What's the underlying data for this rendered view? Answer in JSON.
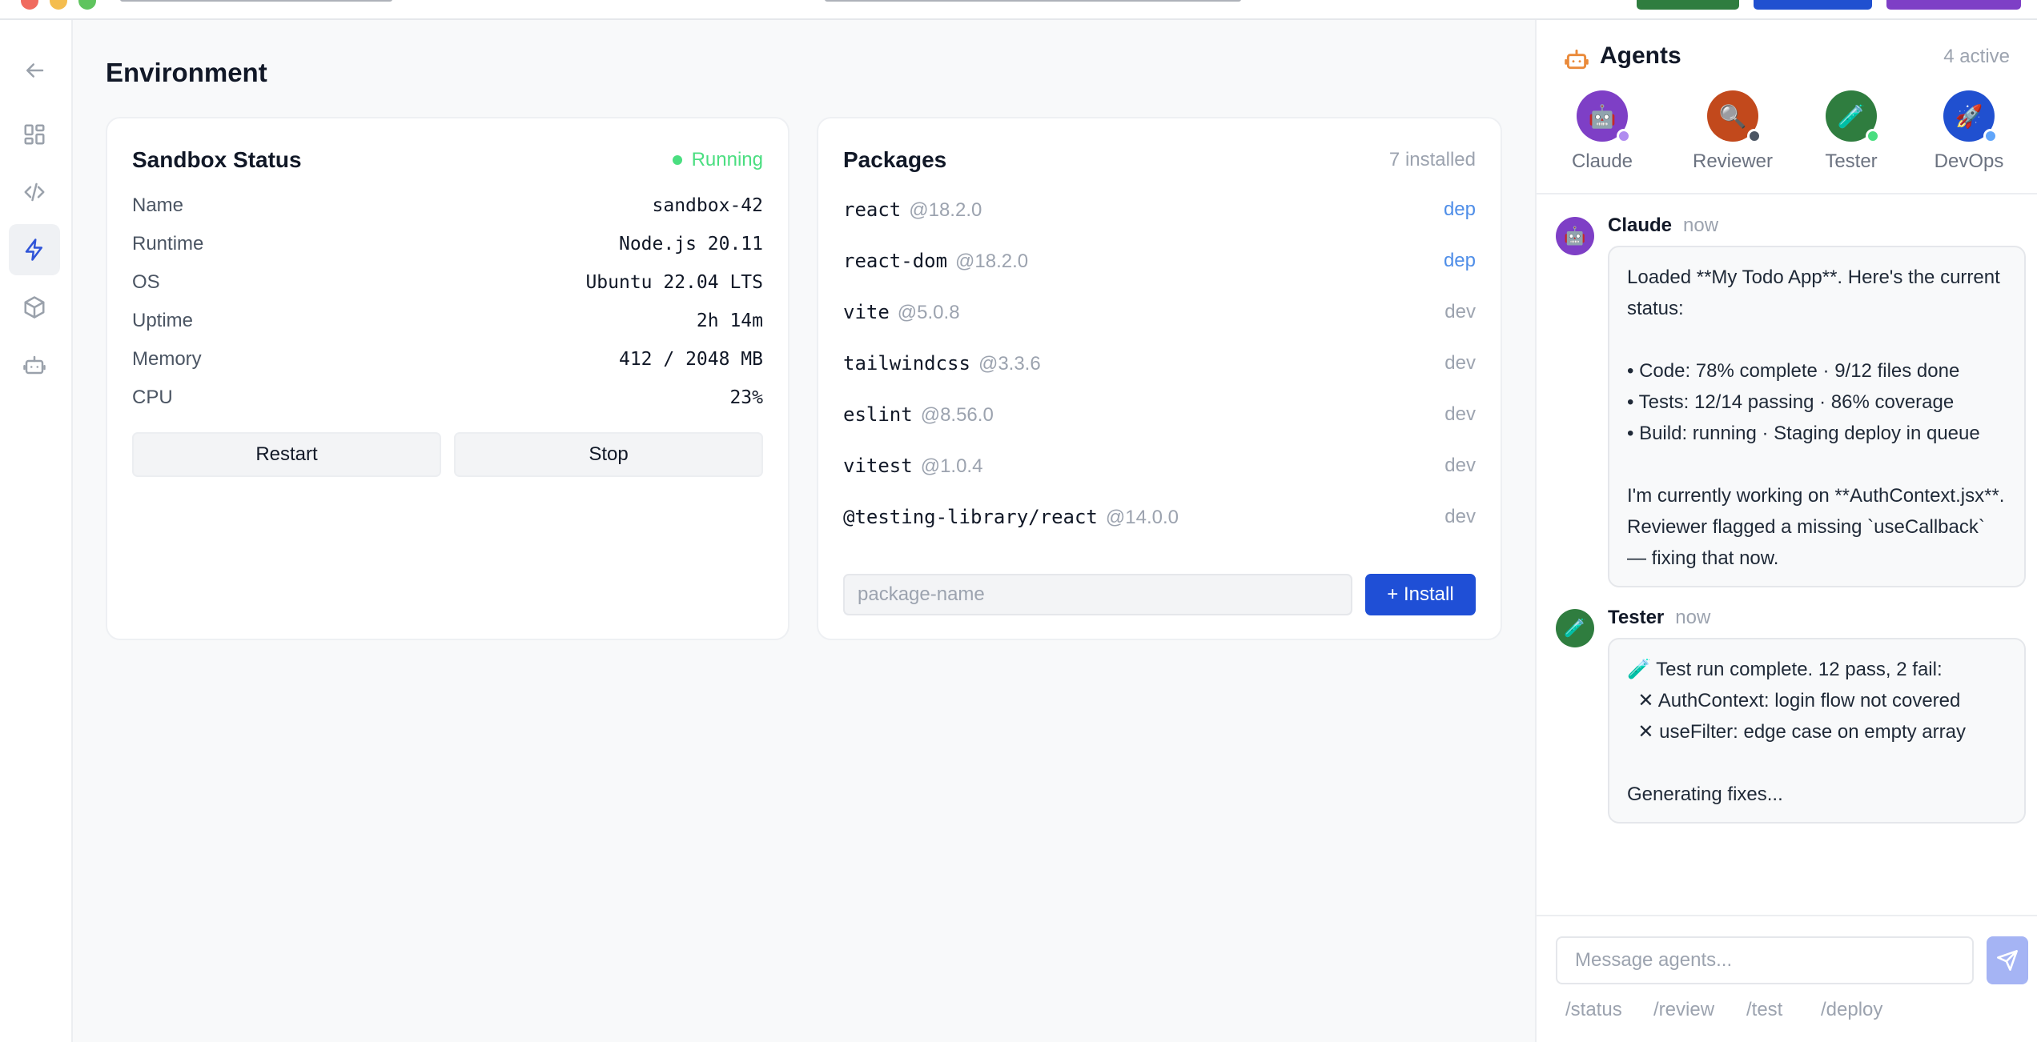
{
  "colors": {
    "accent": "#1f4fd6",
    "status_running": "#4ade80",
    "dep_tag": "#4f8ee8",
    "agents_icon": "#ea8a3a"
  },
  "sidebar": {
    "items": [
      {
        "icon": "back-arrow-icon"
      },
      {
        "icon": "grid-icon"
      },
      {
        "icon": "code-icon"
      },
      {
        "icon": "lightning-icon",
        "active": true
      },
      {
        "icon": "package-icon"
      },
      {
        "icon": "robot-icon"
      }
    ]
  },
  "main": {
    "title": "Environment",
    "sandbox": {
      "title": "Sandbox Status",
      "status": "Running",
      "rows": [
        {
          "key": "Name",
          "value": "sandbox-42"
        },
        {
          "key": "Runtime",
          "value": "Node.js 20.11"
        },
        {
          "key": "OS",
          "value": "Ubuntu 22.04 LTS"
        },
        {
          "key": "Uptime",
          "value": "2h 14m"
        },
        {
          "key": "Memory",
          "value": "412 / 2048 MB"
        },
        {
          "key": "CPU",
          "value": "23%"
        }
      ],
      "restart_label": "Restart",
      "stop_label": "Stop"
    },
    "packages": {
      "title": "Packages",
      "count": "7 installed",
      "items": [
        {
          "name": "react",
          "version": "@18.2.0",
          "type": "dep"
        },
        {
          "name": "react-dom",
          "version": "@18.2.0",
          "type": "dep"
        },
        {
          "name": "vite",
          "version": "@5.0.8",
          "type": "dev"
        },
        {
          "name": "tailwindcss",
          "version": "@3.3.6",
          "type": "dev"
        },
        {
          "name": "eslint",
          "version": "@8.56.0",
          "type": "dev"
        },
        {
          "name": "vitest",
          "version": "@1.0.4",
          "type": "dev"
        },
        {
          "name": "@testing-library/react",
          "version": "@14.0.0",
          "type": "dev"
        }
      ],
      "input_placeholder": "package-name",
      "install_label": "+ Install"
    }
  },
  "agents_panel": {
    "title": "Agents",
    "active_count": "4 active",
    "agents": [
      {
        "name": "Claude",
        "icon": "robot-emoji-icon",
        "glyph": "🤖",
        "color": "#7e3fc6",
        "status_color": "#b08cf0"
      },
      {
        "name": "Reviewer",
        "icon": "magnifier-emoji-icon",
        "glyph": "🔍",
        "color": "#c2491c",
        "status_color": "#4b5563"
      },
      {
        "name": "Tester",
        "icon": "test-tube-emoji-icon",
        "glyph": "🧪",
        "color": "#2f7d3f",
        "status_color": "#4ade80"
      },
      {
        "name": "DevOps",
        "icon": "rocket-emoji-icon",
        "glyph": "🚀",
        "color": "#2050d0",
        "status_color": "#60a5fa"
      }
    ],
    "messages": [
      {
        "author": "Claude",
        "time": "now",
        "glyph": "🤖",
        "color": "#7e3fc6",
        "text": "Loaded **My Todo App**. Here's the current status:\n\n• Code: 78% complete · 9/12 files done\n• Tests: 12/14 passing · 86% coverage\n• Build: running · Staging deploy in queue\n\nI'm currently working on **AuthContext.jsx**. Reviewer flagged a missing `useCallback` — fixing that now."
      },
      {
        "author": "Tester",
        "time": "now",
        "glyph": "🧪",
        "color": "#2f7d3f",
        "text": "🧪 Test run complete. 12 pass, 2 fail:\n  ✕ AuthContext: login flow not covered\n  ✕ useFilter: edge case on empty array\n\nGenerating fixes..."
      }
    ],
    "input_placeholder": "Message agents...",
    "quick_commands": [
      "/status",
      "/review",
      "/test",
      "/deploy"
    ]
  }
}
